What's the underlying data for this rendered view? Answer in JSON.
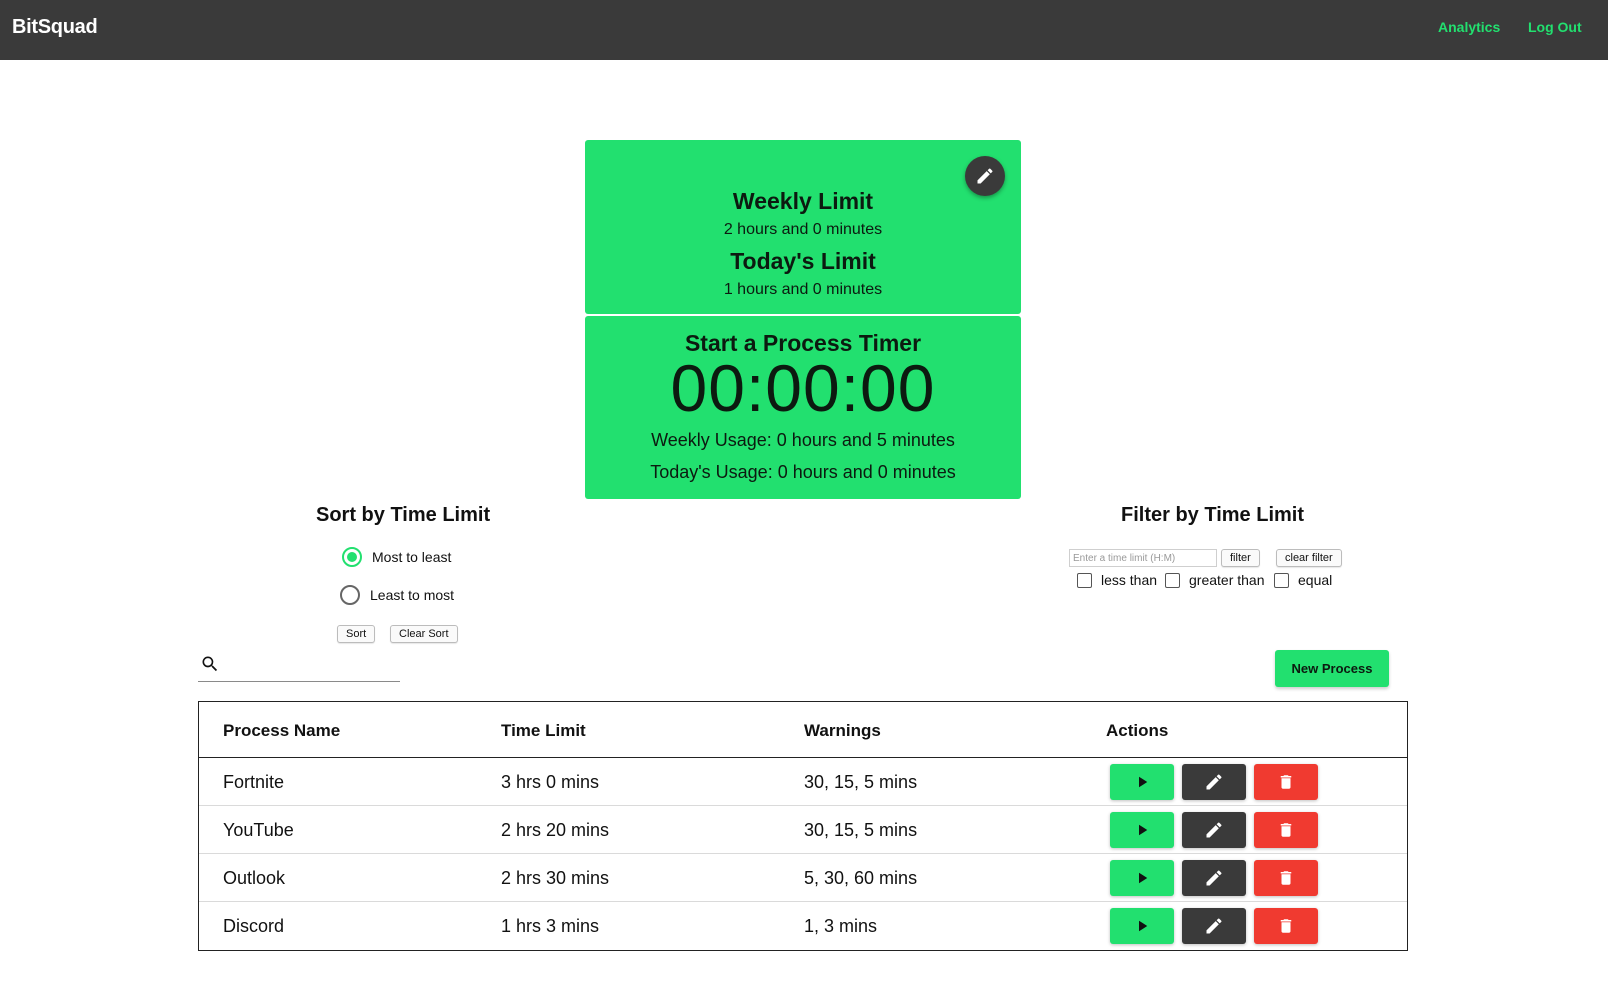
{
  "header": {
    "brand": "BitSquad",
    "nav": {
      "analytics": "Analytics",
      "logout": "Log Out"
    }
  },
  "limits": {
    "weekly_title": "Weekly Limit",
    "weekly_value": "2 hours and 0 minutes",
    "today_title": "Today's Limit",
    "today_value": "1 hours and 0 minutes"
  },
  "timer": {
    "title": "Start a Process Timer",
    "clock": "00:00:00",
    "weekly_usage": "Weekly Usage: 0 hours and 5 minutes",
    "today_usage": "Today's Usage: 0 hours and 0 minutes"
  },
  "sort": {
    "title": "Sort by Time Limit",
    "options": [
      "Most to least",
      "Least to most"
    ],
    "selected": "Most to least",
    "sort_label": "Sort",
    "clear_label": "Clear Sort"
  },
  "filter": {
    "title": "Filter by Time Limit",
    "placeholder": "Enter a time limit (H:M)",
    "filter_label": "filter",
    "clear_label": "clear filter",
    "checks": [
      "less than",
      "greater than",
      "equal"
    ]
  },
  "search": {
    "value": ""
  },
  "new_process_label": "New Process",
  "table": {
    "headers": [
      "Process Name",
      "Time Limit",
      "Warnings",
      "Actions"
    ],
    "rows": [
      [
        "Fortnite",
        "3 hrs 0 mins",
        "30, 15, 5 mins"
      ],
      [
        "YouTube",
        "2 hrs 20 mins",
        "30, 15, 5 mins"
      ],
      [
        "Outlook",
        "2 hrs 30 mins",
        "5, 30, 60 mins"
      ],
      [
        "Discord",
        "1 hrs 3 mins",
        "1, 3 mins"
      ]
    ]
  },
  "icons": {
    "edit": "pencil-icon",
    "play": "play-icon",
    "delete": "trash-icon",
    "search": "search-icon"
  },
  "colors": {
    "accent": "#22e06f",
    "dark": "#3a3a3a",
    "danger": "#f03a30"
  }
}
